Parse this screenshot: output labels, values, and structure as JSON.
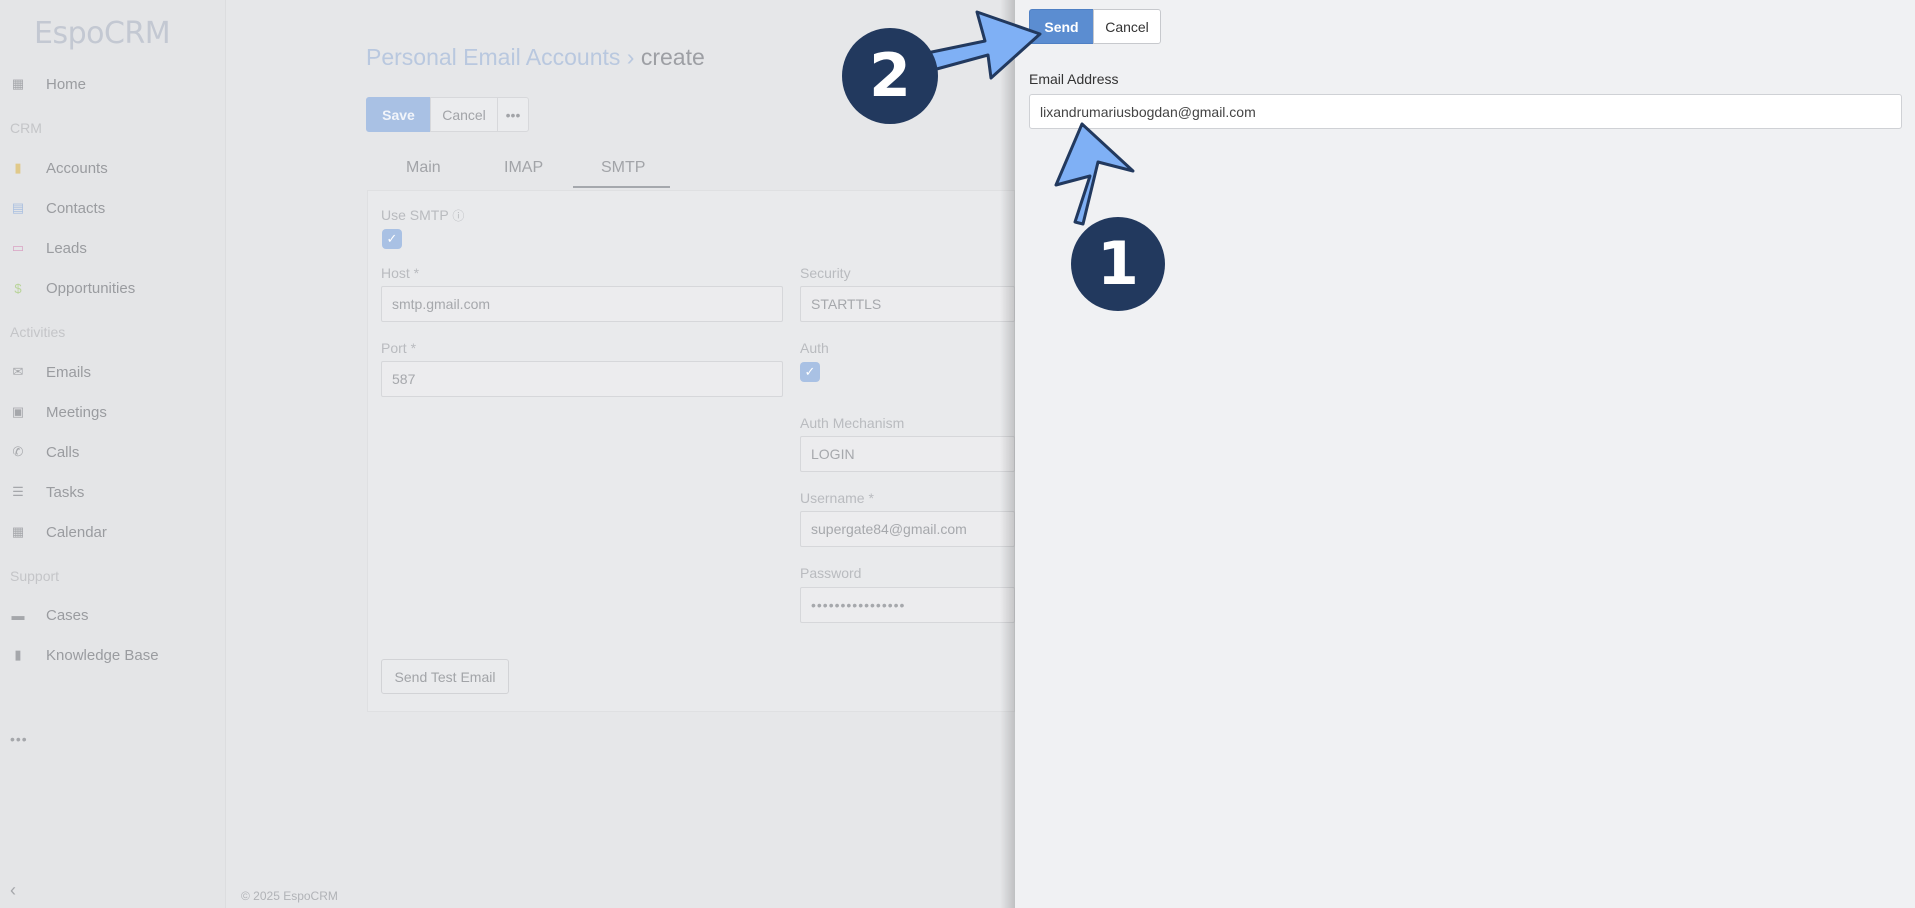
{
  "sidebar": {
    "logo": "EspoCRM",
    "home": "Home",
    "group_crm": "CRM",
    "accounts": "Accounts",
    "contacts": "Contacts",
    "leads": "Leads",
    "opportunities": "Opportunities",
    "group_activities": "Activities",
    "emails": "Emails",
    "meetings": "Meetings",
    "calls": "Calls",
    "tasks": "Tasks",
    "calendar": "Calendar",
    "group_support": "Support",
    "cases": "Cases",
    "knowledge_base": "Knowledge Base",
    "more": "•••",
    "collapse": "‹"
  },
  "footer": "© 2025 EspoCRM",
  "background_page": {
    "title_link": "Personal Email Accounts",
    "title_sep": "›",
    "title_current": "create",
    "save": "Save",
    "cancel": "Cancel",
    "more": "•••",
    "tabs": [
      "Main",
      "IMAP",
      "SMTP"
    ],
    "use_smtp_label": "Use SMTP",
    "host_label": "Host *",
    "host_value": "smtp.gmail.com",
    "security_label": "Security",
    "security_value": "STARTTLS",
    "port_label": "Port *",
    "port_value": "587",
    "auth_label": "Auth",
    "auth_mechanism_label": "Auth Mechanism",
    "auth_mechanism_value": "LOGIN",
    "username_label": "Username *",
    "username_value": "supergate84@gmail.com",
    "password_label": "Password",
    "password_value": "••••••••••••••••",
    "send_test_email": "Send Test Email"
  },
  "dialog": {
    "send": "Send",
    "cancel": "Cancel",
    "email_label": "Email Address",
    "email_value": "lixandrumariusbogdan@gmail.com"
  },
  "annotations": {
    "step1": "1",
    "step2": "2",
    "arrow_color": "#7fb0f5",
    "badge_color": "#22395e"
  }
}
